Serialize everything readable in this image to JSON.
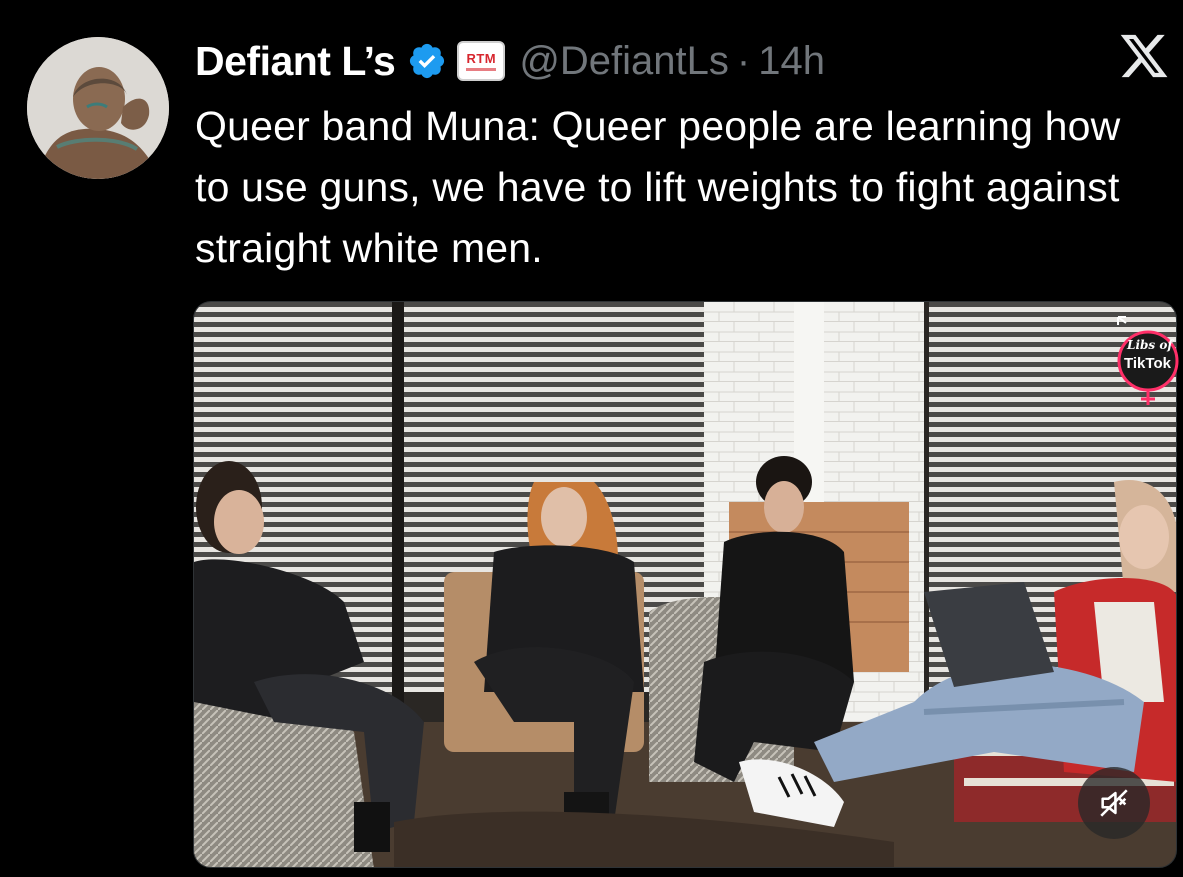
{
  "tweet": {
    "display_name": "Defiant L’s",
    "affiliation_badge": "RTM",
    "handle": "@DefiantLs",
    "separator": "·",
    "timestamp": "14h",
    "text": "Queer band Muna: Queer people are learning how to use guns, we have to lift weights to fight against straight white men."
  },
  "media": {
    "watermark_line1": "Libs of",
    "watermark_line2": "TikTok",
    "mute_icon": "volume-muted-icon"
  },
  "icons": {
    "verified": "verified-badge-icon",
    "platform_logo": "x-logo-icon"
  },
  "colors": {
    "background": "#000000",
    "text": "#ffffff",
    "secondary_text": "#71767b",
    "verified_blue": "#1d9bf0",
    "rtm_red": "#d7262e"
  }
}
